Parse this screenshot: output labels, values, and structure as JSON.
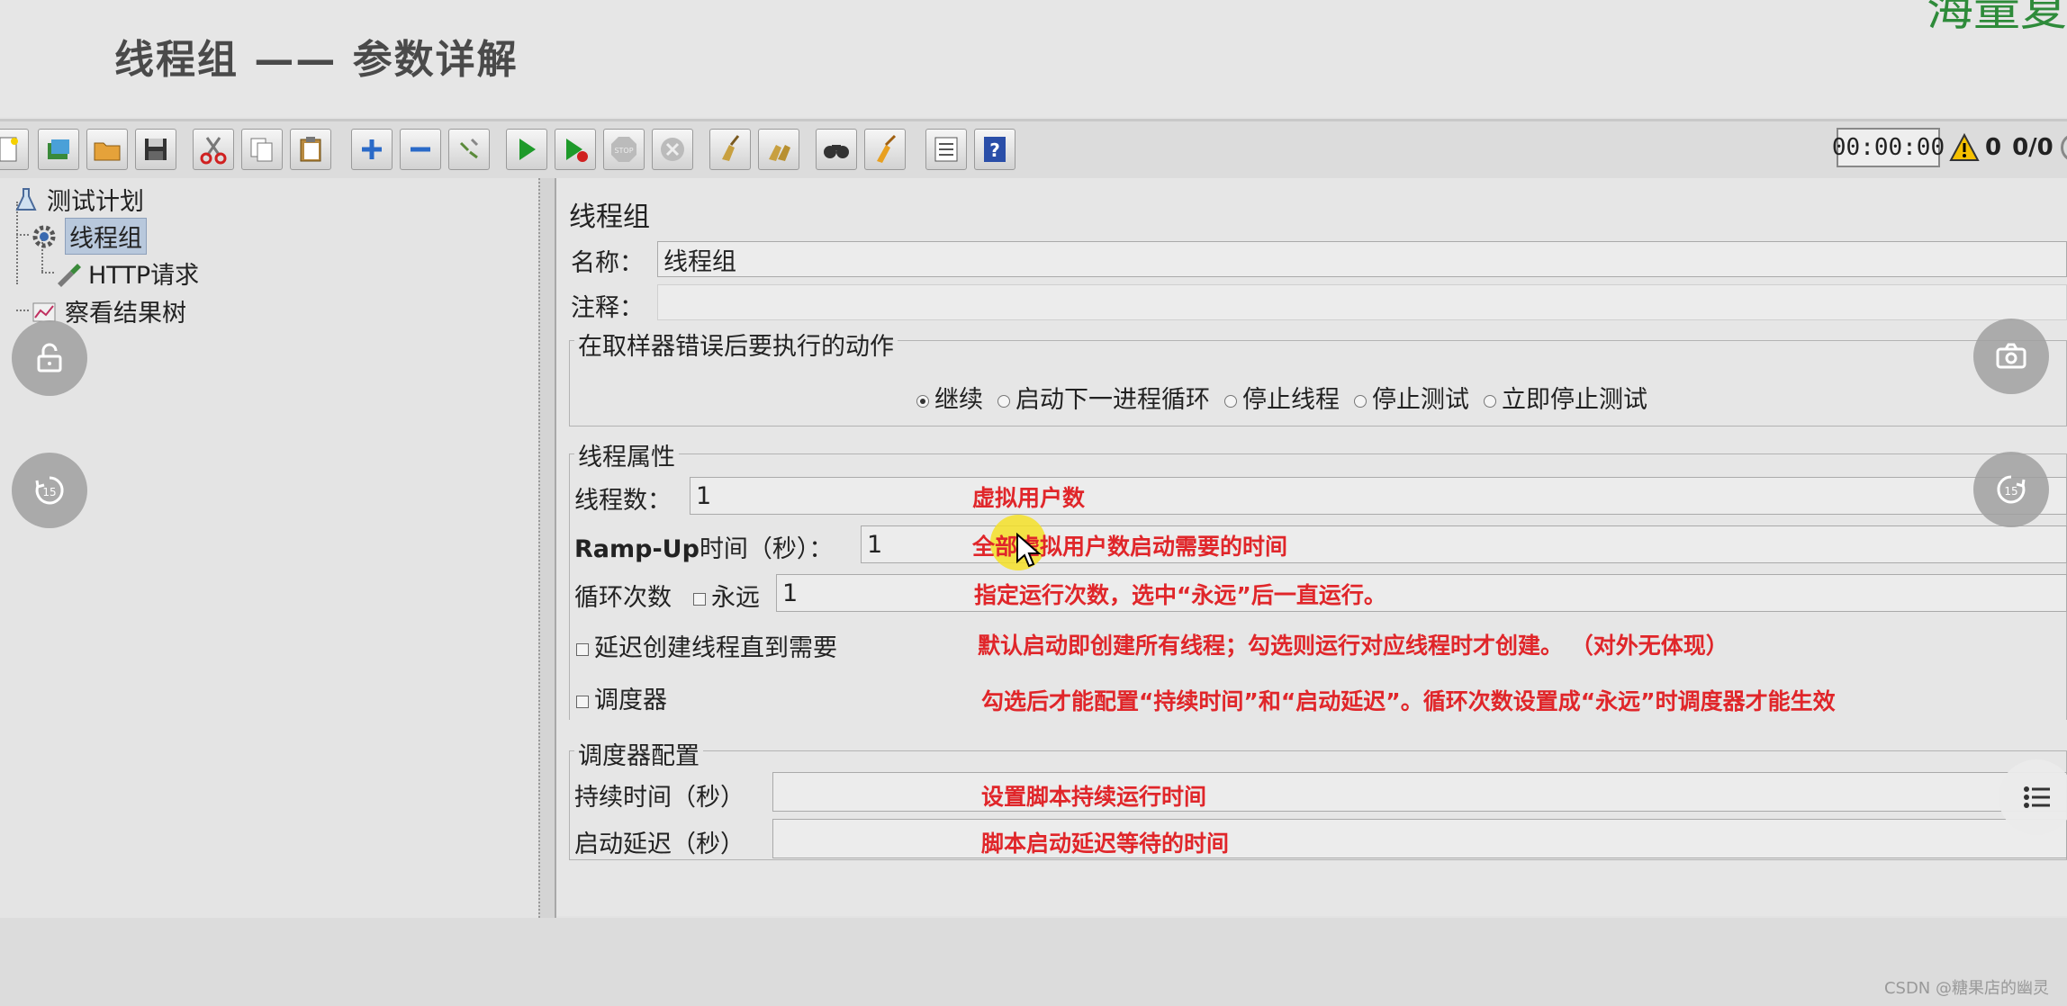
{
  "slide": {
    "title": "线程组 —— 参数详解",
    "corner_text": "海量复"
  },
  "toolbar": {
    "buttons": [
      "new-icon",
      "templates-icon",
      "open-icon",
      "save-icon",
      "cut-icon",
      "copy-icon",
      "paste-icon",
      "expand-icon",
      "collapse-icon",
      "toggle-icon",
      "start-icon",
      "start-no-pause-icon",
      "stop-icon",
      "shutdown-icon",
      "clear-icon",
      "clear-all-icon",
      "search-icon",
      "reset-search-icon",
      "function-helper-icon",
      "help-icon"
    ],
    "timer": "00:00:00",
    "warning_count": "0",
    "threads": "0/0"
  },
  "tree": {
    "items": [
      {
        "label": "测试计划",
        "icon": "flask-icon"
      },
      {
        "label": "线程组",
        "icon": "gear-icon"
      },
      {
        "label": "HTTP请求",
        "icon": "pipette-icon"
      },
      {
        "label": "察看结果树",
        "icon": "chart-icon"
      }
    ]
  },
  "panel": {
    "title": "线程组",
    "name_label": "名称：",
    "name_value": "线程组",
    "comment_label": "注释：",
    "comment_value": "",
    "error_action": {
      "legend": "在取样器错误后要执行的动作",
      "options": [
        "继续",
        "启动下一进程循环",
        "停止线程",
        "停止测试",
        "立即停止测试"
      ],
      "selected": 0
    },
    "thread_props": {
      "legend": "线程属性",
      "threads_label": "线程数：",
      "threads_value": "1",
      "rampup_label_bold": "Ramp-Up",
      "rampup_label_rest": "时间（秒）：",
      "rampup_value": "1",
      "loop_label": "循环次数",
      "forever_label": "永远",
      "loop_value": "1",
      "delay_label": "延迟创建线程直到需要",
      "scheduler_label": "调度器"
    },
    "scheduler_config": {
      "legend": "调度器配置",
      "duration_label": "持续时间（秒）",
      "duration_value": "",
      "startup_delay_label": "启动延迟（秒）",
      "startup_delay_value": ""
    }
  },
  "annotations": {
    "threads": "虚拟用户数",
    "rampup": "全部虚拟用户数启动需要的时间",
    "loop": "指定运行次数，选中“永远”后一直运行。",
    "delay": "默认启动即创建所有线程；勾选则运行对应线程时才创建。 （对外无体现）",
    "scheduler": "勾选后才能配置“持续时间”和“启动延迟”。循环次数设置成“永远”时调度器才能生效",
    "duration": "设置脚本持续运行时间",
    "startup_delay": "脚本启动延迟等待的时间"
  },
  "overlay": {
    "left_buttons": [
      "unlock-icon",
      "rewind-15-icon"
    ],
    "right_buttons": [
      "camera-icon",
      "forward-15-icon",
      "list-icon"
    ],
    "replay_label": "15"
  },
  "watermark": "CSDN @糖果店的幽灵",
  "colors": {
    "annotation": "#e0262a",
    "corner_text": "#2e8b3a",
    "selection": "#b8c8dc"
  }
}
